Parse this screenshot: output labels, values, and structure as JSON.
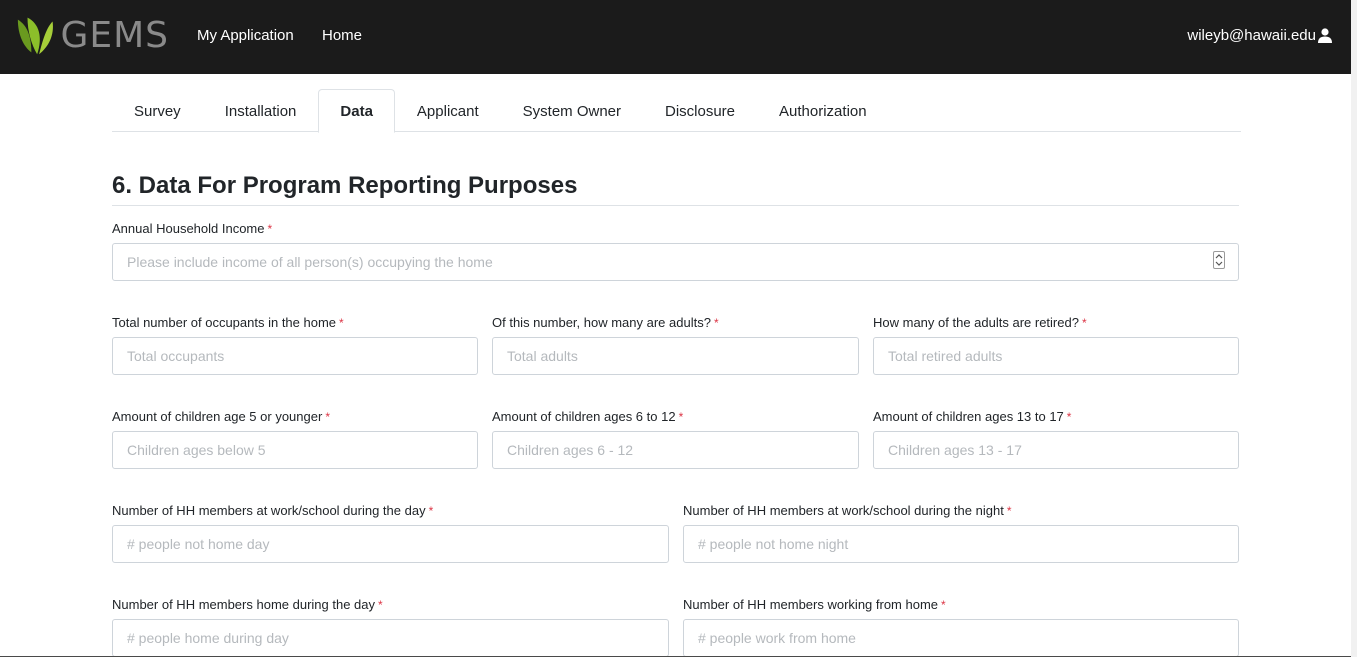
{
  "navbar": {
    "logo_text": "GEMS",
    "links": [
      "My Application",
      "Home"
    ],
    "user_email": "wileyb@hawaii.edu"
  },
  "tabs": [
    {
      "label": "Survey",
      "active": false
    },
    {
      "label": "Installation",
      "active": false
    },
    {
      "label": "Data",
      "active": true
    },
    {
      "label": "Applicant",
      "active": false
    },
    {
      "label": "System Owner",
      "active": false
    },
    {
      "label": "Disclosure",
      "active": false
    },
    {
      "label": "Authorization",
      "active": false
    }
  ],
  "section": {
    "title": "6. Data For Program Reporting Purposes"
  },
  "required_mark": "*",
  "fields": {
    "income": {
      "label": "Annual Household Income",
      "placeholder": "Please include income of all person(s) occupying the home"
    },
    "occupants": {
      "label": "Total number of occupants in the home",
      "placeholder": "Total occupants"
    },
    "adults": {
      "label": "Of this number, how many are adults?",
      "placeholder": "Total adults"
    },
    "retired": {
      "label": "How many of the adults are retired?",
      "placeholder": "Total retired adults"
    },
    "children_5": {
      "label": "Amount of children age 5 or younger",
      "placeholder": "Children ages below 5"
    },
    "children_6_12": {
      "label": "Amount of children ages 6 to 12",
      "placeholder": "Children ages 6 - 12"
    },
    "children_13_17": {
      "label": "Amount of children ages 13 to 17",
      "placeholder": "Children ages 13 - 17"
    },
    "away_day": {
      "label": "Number of HH members at work/school during the day",
      "placeholder": "# people not home day"
    },
    "away_night": {
      "label": "Number of HH members at work/school during the night",
      "placeholder": "# people not home night"
    },
    "home_day": {
      "label": "Number of HH members home during the day",
      "placeholder": "# people home during day"
    },
    "work_home": {
      "label": "Number of HH members working from home",
      "placeholder": "# people work from home"
    }
  },
  "colors": {
    "navbar_bg": "#1b1b1b",
    "logo_green_dark": "#6a9a1f",
    "logo_green_light": "#a6ce39",
    "required": "#dc3545"
  }
}
